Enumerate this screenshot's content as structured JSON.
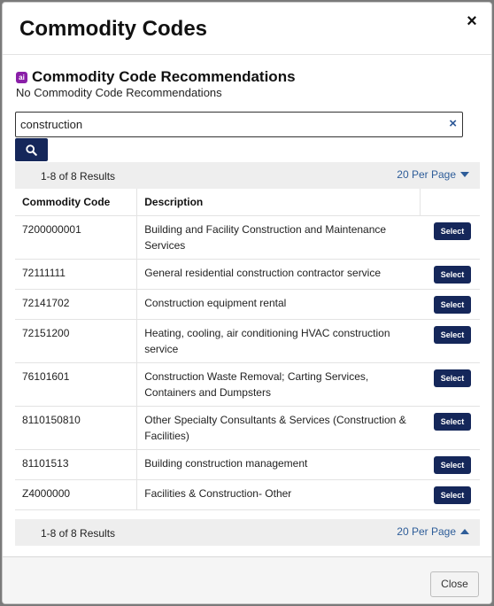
{
  "modal": {
    "title": "Commodity Codes",
    "close_glyph": "×"
  },
  "recommendations": {
    "icon_text": "ai",
    "title": "Commodity Code Recommendations",
    "subtitle": "No Commodity Code Recommendations"
  },
  "search": {
    "value": "construction",
    "clear_glyph": "×",
    "button_icon": "search-icon"
  },
  "pager": {
    "count_text": "1-8 of 8 Results",
    "per_page_label": "20 Per Page"
  },
  "table": {
    "headers": {
      "code": "Commodity Code",
      "description": "Description"
    },
    "select_label": "Select",
    "rows": [
      {
        "code": "7200000001",
        "description": "Building and Facility Construction and Maintenance Services"
      },
      {
        "code": "72111111",
        "description": "General residential construction contractor service"
      },
      {
        "code": "72141702",
        "description": "Construction equipment rental"
      },
      {
        "code": "72151200",
        "description": "Heating, cooling, air conditioning HVAC construction service"
      },
      {
        "code": "76101601",
        "description": "Construction Waste Removal; Carting Services, Containers and Dumpsters"
      },
      {
        "code": "8110150810",
        "description": "Other Specialty Consultants & Services (Construction & Facilities)"
      },
      {
        "code": "81101513",
        "description": "Building construction management"
      },
      {
        "code": "Z4000000",
        "description": "Facilities & Construction- Other"
      }
    ]
  },
  "footer": {
    "close_label": "Close"
  },
  "colors": {
    "primary_button": "#15275a",
    "link": "#2e5d99",
    "ai_badge": "#8a1fa8"
  }
}
